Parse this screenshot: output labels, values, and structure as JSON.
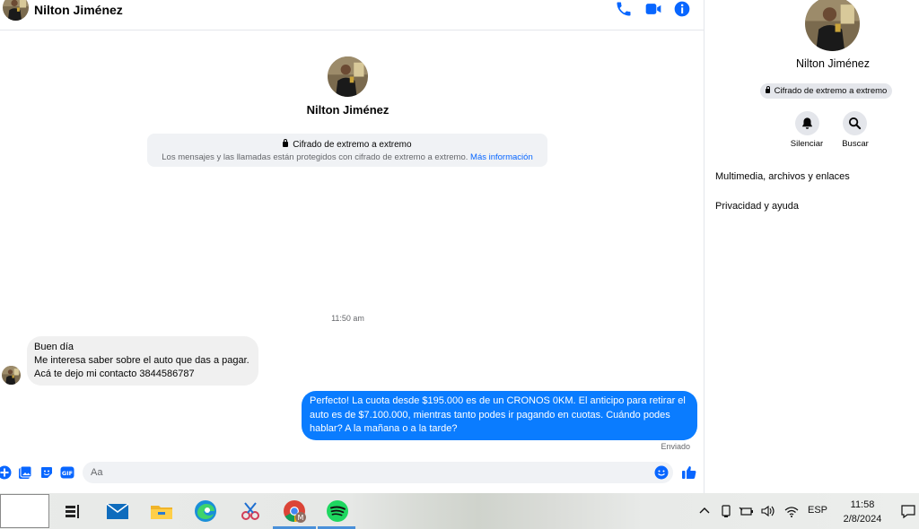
{
  "contact": {
    "name": "Nilton Jiménez"
  },
  "chat": {
    "intro_name": "Nilton Jiménez",
    "encryption": {
      "title": "Cifrado de extremo a extremo",
      "description": "Los mensajes y las llamadas están protegidos con cifrado de extremo a extremo.",
      "link": "Más información"
    },
    "timestamp": "11:50 am",
    "messages": [
      {
        "direction": "incoming",
        "lines": [
          "Buen día",
          "Me interesa saber sobre el auto que das a pagar.",
          "Acá te dejo mi contacto 3844586787"
        ]
      },
      {
        "direction": "outgoing",
        "text": "Perfecto! La cuota desde $195.000 es de un CRONOS 0KM. El anticipo para retirar el auto es de $7.100.000, mientras tanto podes ir pagando en cuotas. Cuándo podes hablar? A la mañana o a la tarde?",
        "status": "Enviado"
      }
    ],
    "composer": {
      "placeholder": "Aa"
    }
  },
  "side_panel": {
    "name": "Nilton Jiménez",
    "encryption_badge": "Cifrado de extremo a extremo",
    "actions": [
      {
        "label": "Silenciar",
        "icon": "bell-icon"
      },
      {
        "label": "Buscar",
        "icon": "search-icon"
      }
    ],
    "sections": [
      "Multimedia, archivos y enlaces",
      "Privacidad y ayuda"
    ]
  },
  "taskbar": {
    "language": "ESP",
    "time": "11:58",
    "date": "2/8/2024",
    "apps": [
      "task-view-icon",
      "mail-icon",
      "file-explorer-icon",
      "edge-icon",
      "snipping-tool-icon",
      "chrome-icon",
      "spotify-icon"
    ]
  },
  "colors": {
    "accent": "#0a7cff",
    "header_icon": "#0866ff",
    "bubble_in": "#f0f0f0",
    "panel_gray": "#e4e6eb",
    "spotify": "#1ed760"
  }
}
